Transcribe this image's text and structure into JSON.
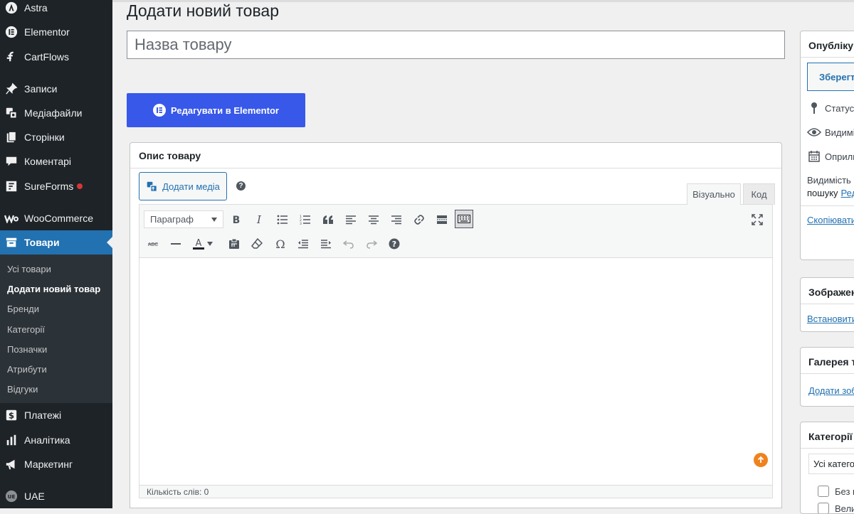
{
  "sidebar": {
    "items": [
      {
        "key": "astra",
        "label": "Astra",
        "icon": "astra-icon"
      },
      {
        "key": "elementor",
        "label": "Elementor",
        "icon": "elementor-icon"
      },
      {
        "key": "cartflows",
        "label": "CartFlows",
        "icon": "cartflows-icon"
      },
      {
        "key": "posts",
        "label": "Записи",
        "icon": "pin-icon"
      },
      {
        "key": "media",
        "label": "Медіафайли",
        "icon": "media-icon"
      },
      {
        "key": "pages",
        "label": "Сторінки",
        "icon": "pages-icon"
      },
      {
        "key": "comments",
        "label": "Коментарі",
        "icon": "comment-icon"
      },
      {
        "key": "sureforms",
        "label": "SureForms",
        "icon": "sureforms-icon"
      },
      {
        "key": "woocommerce",
        "label": "WooCommerce",
        "icon": "woocommerce-icon"
      },
      {
        "key": "products",
        "label": "Товари",
        "icon": "archive-icon"
      },
      {
        "key": "payments",
        "label": "Платежі",
        "icon": "dollar-icon"
      },
      {
        "key": "analytics",
        "label": "Аналітика",
        "icon": "chart-bar-icon"
      },
      {
        "key": "marketing",
        "label": "Маркетинг",
        "icon": "megaphone-icon"
      },
      {
        "key": "uae",
        "label": "UAE",
        "icon": "uae-icon"
      }
    ],
    "submenu": [
      {
        "label": "Усі товари"
      },
      {
        "label": "Додати новий товар"
      },
      {
        "label": "Бренди"
      },
      {
        "label": "Категорії"
      },
      {
        "label": "Позначки"
      },
      {
        "label": "Атрибути"
      },
      {
        "label": "Відгуки"
      }
    ]
  },
  "page": {
    "title": "Додати новий товар",
    "title_placeholder": "Назва товару",
    "elementor_button": "Редагувати в Elementor"
  },
  "description_box": {
    "title": "Опис товару",
    "add_media": "Додати медіа",
    "help": "?",
    "tab_visual": "Візуально",
    "tab_code": "Код",
    "format_select": "Параграф",
    "word_count": "Кількість слів: 0"
  },
  "publish_box": {
    "title": "Опублікувати",
    "save_draft": "Зберегти чернетку",
    "status_label": "Статус:",
    "visibility_label": "Видимість:",
    "published_label": "Оприлюднено:",
    "catalog_text_1": "Видимість в каталозі:",
    "catalog_text_2": "пошуку",
    "catalog_link": "Редагувати",
    "copy_link": "Скопіювати"
  },
  "image_box": {
    "title": "Зображення товару",
    "link": "Встановити"
  },
  "gallery_box": {
    "title": "Галерея товару",
    "link": "Додати зображення"
  },
  "categories_box": {
    "title": "Категорії товарів",
    "tab_all": "Усі категорії",
    "items": [
      {
        "label": "Без категорії"
      },
      {
        "label": "Велика"
      }
    ]
  },
  "colors": {
    "sidebar_bg": "#1d2327",
    "active_menu": "#2271b1",
    "elementor_blue": "#3858e9",
    "notification_dot": "#d63638"
  }
}
